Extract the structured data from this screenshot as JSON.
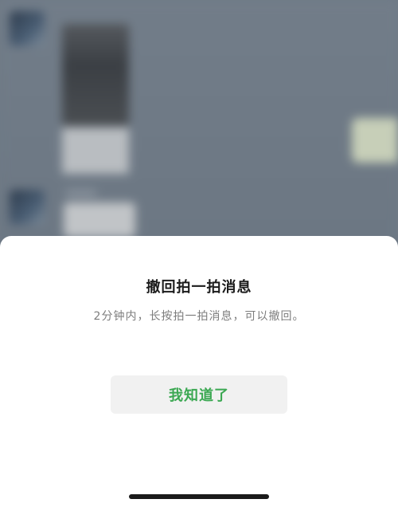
{
  "sheet": {
    "title": "撤回拍一拍消息",
    "description": "2分钟内，长按拍一拍消息，可以撤回。",
    "ok_label": "我知道了"
  },
  "colors": {
    "accent": "#3ba852",
    "sheet_background": "#ffffff",
    "button_background": "#f1f1f1",
    "overlay": "#6f7a86"
  }
}
